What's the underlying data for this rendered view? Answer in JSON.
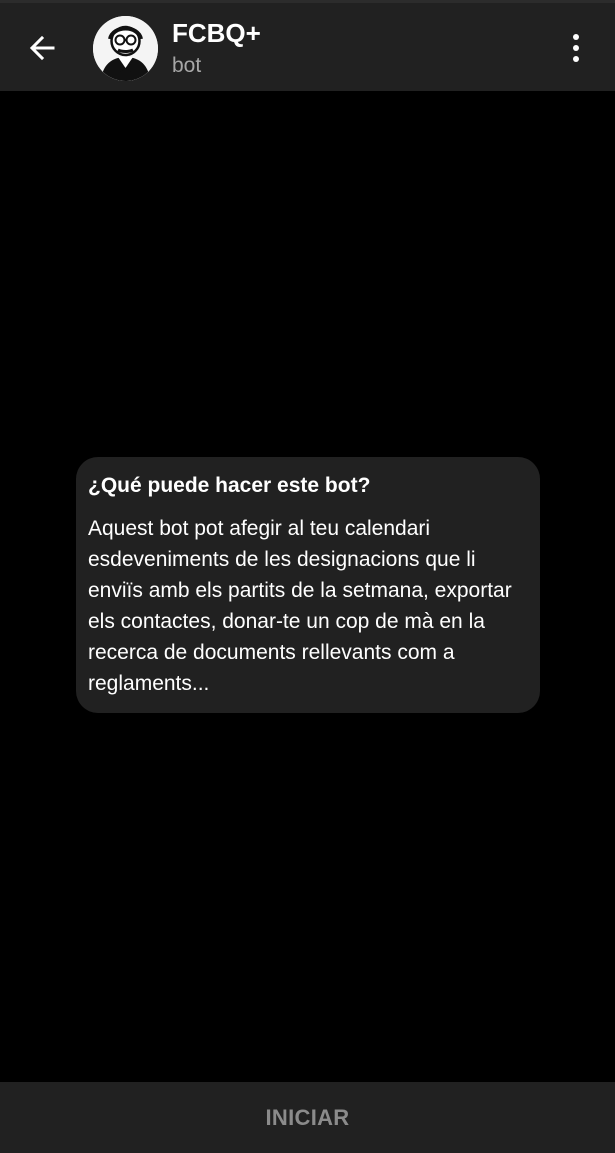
{
  "header": {
    "title": "FCBQ+",
    "subtitle": "bot",
    "back_icon": "arrow-left-icon",
    "menu_icon": "more-vertical-icon"
  },
  "avatar": {
    "icon": "bot-avatar-icon"
  },
  "chat": {
    "card_title": "¿Qué puede hacer este bot?",
    "card_body": "Aquest bot pot afegir al teu calendari esdeveniments de les designacions que li enviïs amb els partits de la setmana, exportar els contactes, donar-te un cop de mà en la recerca de documents rellevants com a reglaments..."
  },
  "bottom_bar": {
    "button_label": "INICIAR"
  },
  "colors": {
    "background": "#000000",
    "surface": "#212121",
    "muted_text": "#a7a7a7",
    "button_text": "#8b8b8b"
  }
}
